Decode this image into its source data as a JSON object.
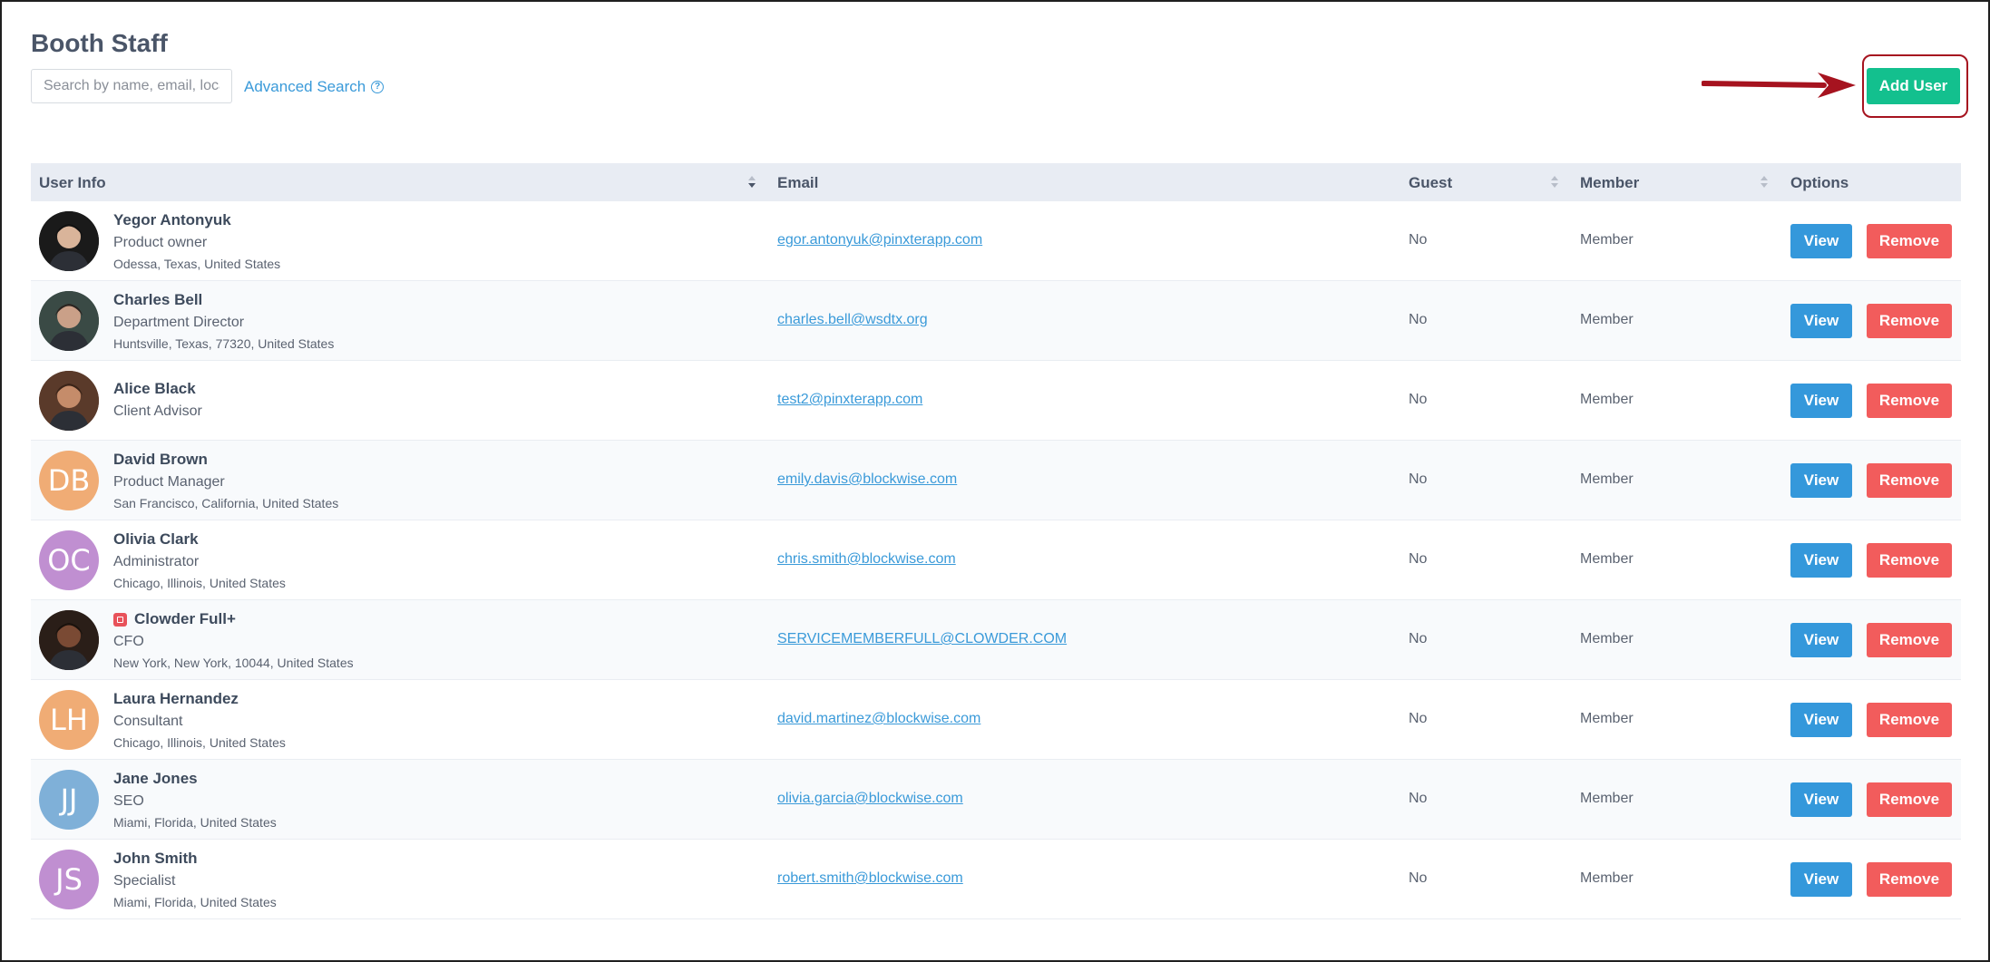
{
  "page": {
    "title": "Booth Staff"
  },
  "search": {
    "placeholder": "Search by name, email, location"
  },
  "advanced_search": {
    "label": "Advanced Search",
    "icon": "help-circle-icon"
  },
  "add_user": {
    "label": "Add User",
    "color": "#13c08e"
  },
  "annotation": {
    "arrow_color": "#a6131f"
  },
  "table": {
    "headers": {
      "user_info": "User Info",
      "email": "Email",
      "guest": "Guest",
      "member": "Member",
      "options": "Options"
    },
    "rows": [
      {
        "name": "Yegor Antonyuk",
        "title": "Product owner",
        "location": "Odessa, Texas, United States",
        "email": "egor.antonyuk@pinxterapp.com",
        "guest": "No",
        "member": "Member",
        "avatar": {
          "type": "photo",
          "initials": "",
          "color": "#1a1a1a"
        }
      },
      {
        "name": "Charles Bell",
        "title": "Department Director",
        "location": "Huntsville, Texas, 77320, United States",
        "email": "charles.bell@wsdtx.org",
        "guest": "No",
        "member": "Member",
        "avatar": {
          "type": "photo",
          "initials": "",
          "color": "#3a4a45"
        }
      },
      {
        "name": "Alice Black",
        "title": "Client Advisor",
        "location": "",
        "email": "test2@pinxterapp.com",
        "guest": "No",
        "member": "Member",
        "avatar": {
          "type": "photo",
          "initials": "",
          "color": "#5a3a2a"
        }
      },
      {
        "name": "David Brown",
        "title": "Product Manager",
        "location": "San Francisco, California, United States",
        "email": "emily.davis@blockwise.com",
        "guest": "No",
        "member": "Member",
        "avatar": {
          "type": "initials",
          "initials": "DB",
          "color": "#f0ac75"
        }
      },
      {
        "name": "Olivia Clark",
        "title": "Administrator",
        "location": "Chicago, Illinois, United States",
        "email": "chris.smith@blockwise.com",
        "guest": "No",
        "member": "Member",
        "avatar": {
          "type": "initials",
          "initials": "OC",
          "color": "#c08fd1"
        }
      },
      {
        "name": "Clowder Full+",
        "title": "CFO",
        "location": "New York, New York, 10044, United States",
        "email": "SERVICEMEMBERFULL@CLOWDER.COM",
        "guest": "No",
        "member": "Member",
        "avatar": {
          "type": "photo",
          "initials": "",
          "color": "#2a1e18"
        },
        "external": true
      },
      {
        "name": "Laura Hernandez",
        "title": "Consultant",
        "location": "Chicago, Illinois, United States",
        "email": "david.martinez@blockwise.com",
        "guest": "No",
        "member": "Member",
        "avatar": {
          "type": "initials",
          "initials": "LH",
          "color": "#f0ac75"
        }
      },
      {
        "name": "Jane Jones",
        "title": "SEO",
        "location": "Miami, Florida, United States",
        "email": "olivia.garcia@blockwise.com",
        "guest": "No",
        "member": "Member",
        "avatar": {
          "type": "initials",
          "initials": "JJ",
          "color": "#7fb0d8"
        }
      },
      {
        "name": "John Smith",
        "title": "Specialist",
        "location": "Miami, Florida, United States",
        "email": "robert.smith@blockwise.com",
        "guest": "No",
        "member": "Member",
        "avatar": {
          "type": "initials",
          "initials": "JS",
          "color": "#c08fd1"
        }
      }
    ],
    "actions": {
      "view": "View",
      "remove": "Remove"
    }
  }
}
